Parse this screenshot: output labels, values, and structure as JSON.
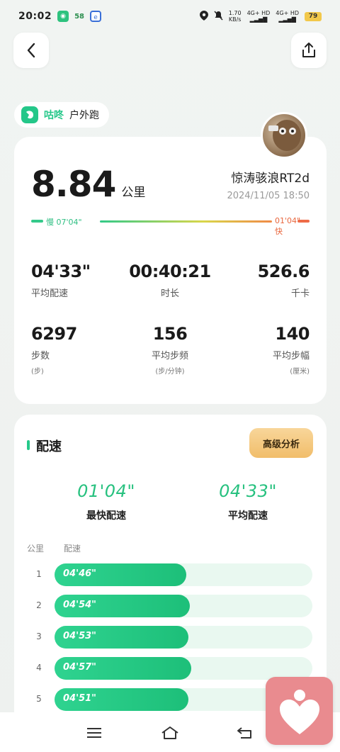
{
  "status_bar": {
    "time": "20:02",
    "notif_count": "58",
    "net_speed_value": "1.70",
    "net_speed_unit": "KB/s",
    "net1": "4G+ HD",
    "net2": "4G+ HD",
    "battery": "79"
  },
  "brand": {
    "name": "咕咚",
    "activity_type": "户外跑"
  },
  "summary_card": {
    "distance": "8.84",
    "distance_unit": "公里",
    "user_name": "惊涛骇浪RT2d",
    "datetime": "2024/11/05  18:50",
    "pace_scale": {
      "slow_label": "慢 07'04\"",
      "fast_label": "01'04\" 快"
    },
    "stats": [
      {
        "value": "04'33\"",
        "label": "平均配速",
        "sub": ""
      },
      {
        "value": "00:40:21",
        "label": "时长",
        "sub": ""
      },
      {
        "value": "526.6",
        "label": "千卡",
        "sub": ""
      },
      {
        "value": "6297",
        "label": "步数",
        "sub": "(步)"
      },
      {
        "value": "156",
        "label": "平均步频",
        "sub": "(步/分钟)"
      },
      {
        "value": "140",
        "label": "平均步幅",
        "sub": "(厘米)"
      }
    ]
  },
  "pace_card": {
    "title": "配速",
    "advanced_button": "高级分析",
    "fastest_value": "01'04\"",
    "fastest_label": "最快配速",
    "average_value": "04'33\"",
    "average_label": "平均配速",
    "col_km": "公里",
    "col_pace": "配速",
    "rows": [
      {
        "km": "1",
        "pace": "04'46\"",
        "fill": 0.51
      },
      {
        "km": "2",
        "pace": "04'54\"",
        "fill": 0.525
      },
      {
        "km": "3",
        "pace": "04'53\"",
        "fill": 0.52
      },
      {
        "km": "4",
        "pace": "04'57\"",
        "fill": 0.53
      },
      {
        "km": "5",
        "pace": "04'51\"",
        "fill": 0.52
      }
    ]
  },
  "colors": {
    "accent": "#26c98a",
    "advanced_button": "#f4c67c",
    "widget": "#e98b8f"
  }
}
